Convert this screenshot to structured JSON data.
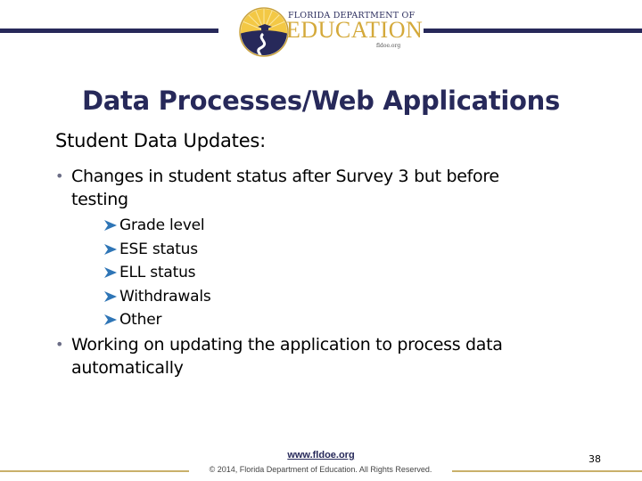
{
  "header": {
    "logo": {
      "line1": "FLORIDA DEPARTMENT OF",
      "line2": "EDUCATION",
      "url": "fldoe.org",
      "icon": "fldoe-emblem-icon"
    },
    "accent_color": "#27295a",
    "gold_color": "#d4a93a"
  },
  "slide": {
    "title": "Data Processes/Web Applications",
    "subtitle": "Student Data Updates:",
    "bullets": [
      {
        "text": "Changes in student status after Survey 3 but before testing",
        "sub_items": [
          "Grade level",
          "ESE status",
          "ELL status",
          "Withdrawals",
          "Other"
        ]
      },
      {
        "text": "Working on updating the application to process data automatically"
      }
    ],
    "bullet_icon": "bullet-dot-icon",
    "sub_bullet_icon": "arrowhead-icon"
  },
  "footer": {
    "link": "www.fldoe.org",
    "copyright": "© 2014, Florida Department of Education. All Rights Reserved.",
    "page_number": "38"
  }
}
